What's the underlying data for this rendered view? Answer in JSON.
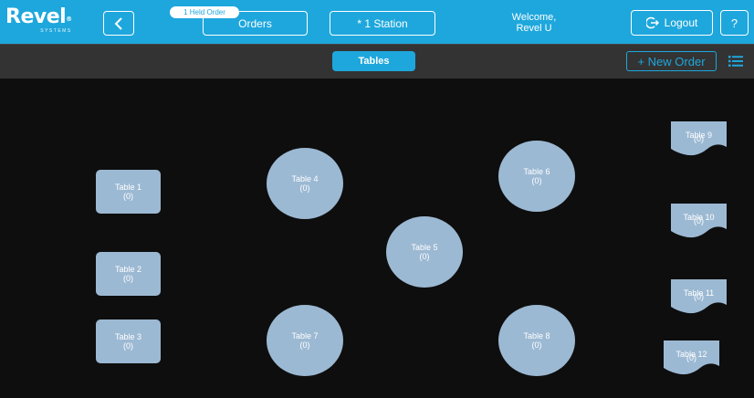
{
  "header": {
    "logo": {
      "word": "Revel",
      "trademark": "®",
      "subtitle": "SYSTEMS"
    },
    "held_order_badge": "1 Held Order",
    "orders_label": "Orders",
    "station_label": "* 1 Station",
    "welcome_line1": "Welcome,",
    "welcome_line2": "Revel U",
    "logout_label": "Logout",
    "help_label": "?",
    "back_icon": "chevron-left-icon",
    "logout_icon": "logout-icon"
  },
  "subbar": {
    "tab_label": "Tables",
    "new_order_label": "+ New Order",
    "view_icon": "list-icon"
  },
  "tables": [
    {
      "name": "Table 1",
      "count": "(0)"
    },
    {
      "name": "Table 2",
      "count": "(0)"
    },
    {
      "name": "Table 3",
      "count": "(0)"
    },
    {
      "name": "Table 4",
      "count": "(0)"
    },
    {
      "name": "Table 5",
      "count": "(0)"
    },
    {
      "name": "Table 6",
      "count": "(0)"
    },
    {
      "name": "Table 7",
      "count": "(0)"
    },
    {
      "name": "Table 8",
      "count": "(0)"
    },
    {
      "name": "Table 9",
      "count": "(0)"
    },
    {
      "name": "Table 10",
      "count": "(0)"
    },
    {
      "name": "Table 11",
      "count": "(0)"
    },
    {
      "name": "Table 12",
      "count": "(0)"
    }
  ],
  "colors": {
    "accent": "#1ea7dc",
    "table_fill": "#9cb9d3",
    "background": "#0e0e0e",
    "subbar": "#333333"
  }
}
